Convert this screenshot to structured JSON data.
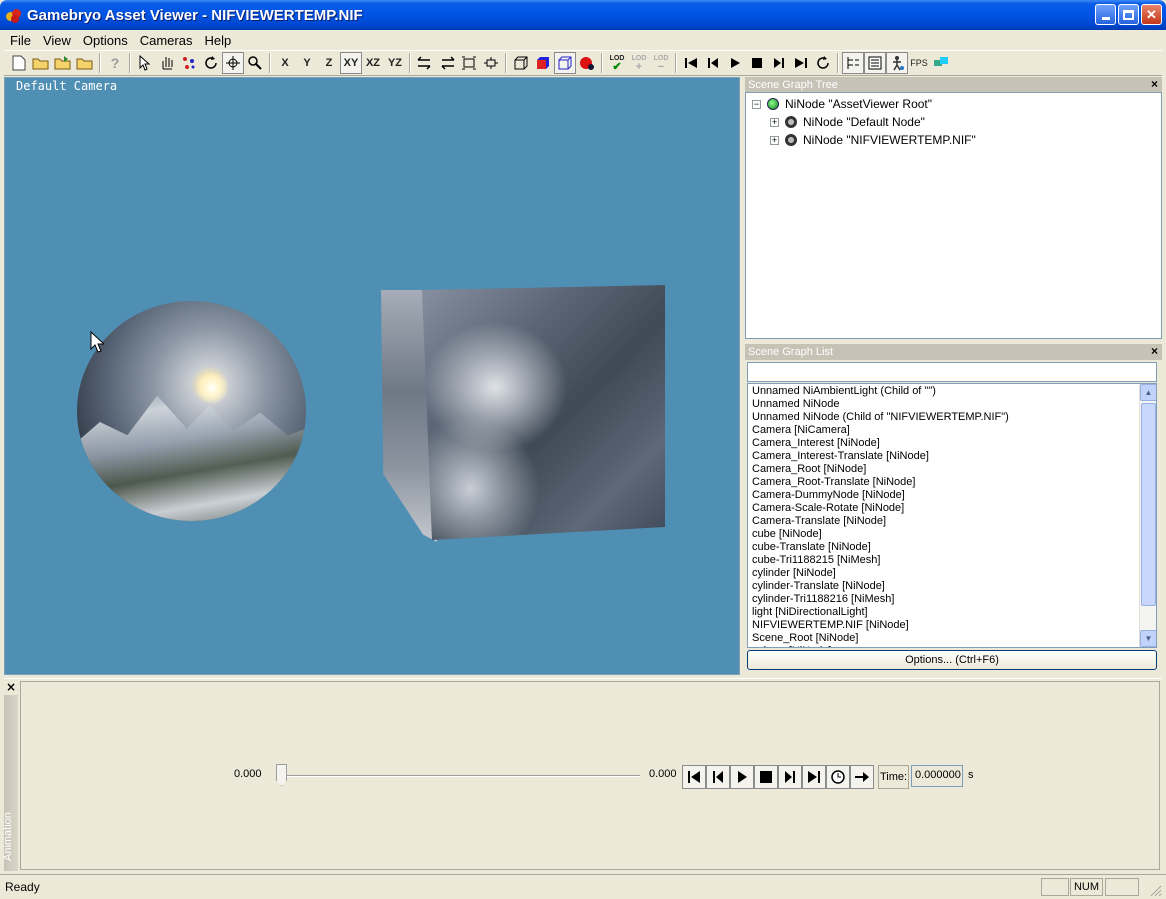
{
  "window": {
    "title": "Gamebryo Asset Viewer - NIFVIEWERTEMP.NIF",
    "min_label": "_",
    "max_label": "□",
    "close_label": "✕"
  },
  "menu": [
    "File",
    "View",
    "Options",
    "Cameras",
    "Help"
  ],
  "toolbar": {
    "axis_x": "X",
    "axis_y": "Y",
    "axis_z": "Z",
    "plane_xy": "XY",
    "plane_xz": "XZ",
    "plane_yz": "YZ",
    "lod": "LOD",
    "fps": "FPS"
  },
  "viewport": {
    "camera_label": "Default Camera",
    "background": "#4f8fb4"
  },
  "scene_tree": {
    "title": "Scene Graph Tree",
    "close": "×",
    "nodes": [
      {
        "expander": "−",
        "label": "NiNode \"AssetViewer Root\""
      },
      {
        "expander": "+",
        "label": "NiNode \"Default Node\""
      },
      {
        "expander": "+",
        "label": "NiNode \"NIFVIEWERTEMP.NIF\""
      }
    ]
  },
  "scene_list": {
    "title": "Scene Graph List",
    "close": "×",
    "filter_value": "",
    "items": [
      " Unnamed NiAmbientLight (Child of \"\")",
      " Unnamed NiNode",
      " Unnamed NiNode (Child of \"NIFVIEWERTEMP.NIF\")",
      "Camera [NiCamera]",
      "Camera_Interest [NiNode]",
      "Camera_Interest-Translate [NiNode]",
      "Camera_Root [NiNode]",
      "Camera_Root-Translate [NiNode]",
      "Camera-DummyNode [NiNode]",
      "Camera-Scale-Rotate [NiNode]",
      "Camera-Translate [NiNode]",
      "cube [NiNode]",
      "cube-Translate [NiNode]",
      "cube-Tri1188215 [NiMesh]",
      "cylinder [NiNode]",
      "cylinder-Translate [NiNode]",
      "cylinder-Tri1188216 [NiMesh]",
      "light [NiDirectionalLight]",
      "NIFVIEWERTEMP.NIF [NiNode]",
      "Scene_Root [NiNode]",
      "sphere [NiNode]"
    ],
    "options_button": "Options... (Ctrl+F6)"
  },
  "animation": {
    "close": "×",
    "sidebar_label": "Animation",
    "start_value": "0.000",
    "end_value": "0.000",
    "time_label": "Time:",
    "time_value": "0.000000",
    "time_unit": "s",
    "position_fraction": 0
  },
  "status": {
    "text": "Ready",
    "num": "NUM"
  }
}
